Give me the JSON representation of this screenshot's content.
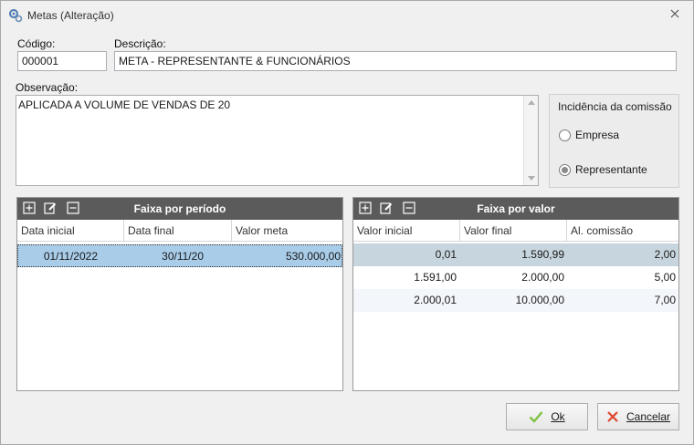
{
  "window": {
    "title": "Metas (Alteração)"
  },
  "fields": {
    "codigo_label": "Código:",
    "codigo_value": "000001",
    "descricao_label": "Descrição:",
    "descricao_value": "META - REPRESENTANTE & FUNCIONÁRIOS",
    "observacao_label": "Observação:",
    "observacao_value": "APLICADA A VOLUME DE VENDAS DE 20"
  },
  "incidencia": {
    "title": "Incidência da comissão",
    "options": [
      {
        "label": "Empresa",
        "checked": false
      },
      {
        "label": "Representante",
        "checked": true
      }
    ]
  },
  "periodo": {
    "title": "Faixa por período",
    "columns": [
      "Data inicial",
      "Data final",
      "Valor meta"
    ],
    "rows": [
      [
        "01/11/2022",
        "30/11/20",
        "530.000,00"
      ]
    ]
  },
  "valor": {
    "title": "Faixa por valor",
    "columns": [
      "Valor inicial",
      "Valor final",
      "Al. comissão"
    ],
    "rows": [
      [
        "0,01",
        "1.590,99",
        "2,00"
      ],
      [
        "1.591,00",
        "2.000,00",
        "5,00"
      ],
      [
        "2.000,01",
        "10.000,00",
        "7,00"
      ]
    ]
  },
  "buttons": {
    "ok_label": "Ok",
    "cancel_label": "Cancelar"
  },
  "icons": {
    "app": "gears-icon",
    "close": "close-icon",
    "add": "plus-square-icon",
    "edit": "edit-icon",
    "remove": "minus-square-icon",
    "ok": "checkmark-icon",
    "cancel": "x-icon"
  },
  "colors": {
    "panel_header": "#5b5b5b",
    "selected_row": "#a9cce9",
    "highlight_row": "#c7d6de",
    "ok_check": "#7cc242",
    "cancel_x": "#e0462e"
  }
}
